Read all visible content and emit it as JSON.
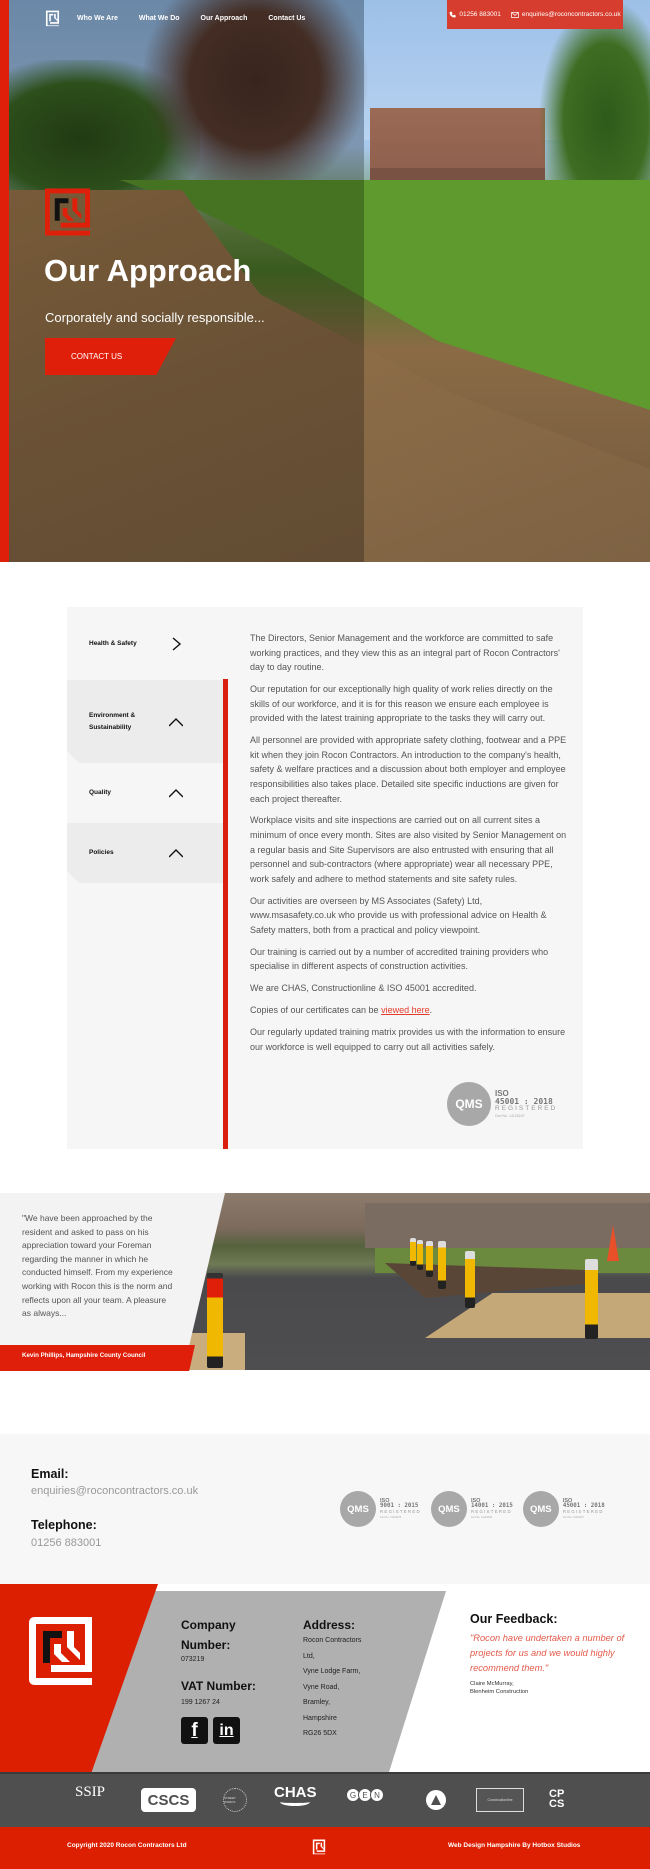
{
  "header": {
    "nav": [
      "Who We Are",
      "What We Do",
      "Our Approach",
      "Contact Us"
    ],
    "phone": "01256 883001",
    "email": "enquiries@roconcontractors.co.uk"
  },
  "hero": {
    "title": "Our Approach",
    "subtitle": "Corporately and socially responsible...",
    "cta_label": "CONTACT US"
  },
  "approach": {
    "tabs": [
      {
        "label": "Health & Safety",
        "icon": "chevron-right-icon",
        "active": true
      },
      {
        "label": "Environment & Sustainability",
        "icon": "chevron-up-icon",
        "active": false
      },
      {
        "label": "Quality",
        "icon": "chevron-up-icon",
        "active": false
      },
      {
        "label": "Policies",
        "icon": "chevron-up-icon",
        "active": false
      }
    ],
    "paragraphs": [
      "The Directors, Senior Management and the workforce are committed to safe working practices, and they view this as an integral part of Rocon Contractors' day to day routine.",
      "Our reputation for our exceptionally high quality of work relies directly on the skills of our workforce, and it is for this reason we ensure each employee is provided with the latest training appropriate to the tasks they will carry out.",
      "All personnel are provided with appropriate safety clothing, footwear and a PPE kit when they join Rocon Contractors. An introduction to the company's health, safety & welfare practices and a discussion about both employer and employee responsibilities also takes place. Detailed site specific inductions are given for each project thereafter.",
      "Workplace visits and site inspections are carried out on all current sites a minimum of once every month. Sites are also visited by Senior Management on a regular basis and Site Supervisors are also entrusted with ensuring that all personnel and sub-contractors (where appropriate) wear all necessary PPE, work safely and adhere to method statements and site safety rules.",
      "Our activities are overseen by MS Associates (Safety) Ltd, www.msasafety.co.uk who provide us with professional advice on Health & Safety matters, both from a practical and policy viewpoint.",
      "Our training is carried out by a number of accredited training providers who specialise in different aspects of construction activities.",
      "We are CHAS, Constructionline & ISO 45001 accredited."
    ],
    "cert_prefix": "Copies of our certificates can be ",
    "cert_link": "viewed here",
    "cert_suffix": ".",
    "last_paragraph": "Our regularly updated training matrix provides us with the information to ensure our workforce is well equipped to carry out all activities safely.",
    "badge": {
      "logo": "QMS",
      "iso": "ISO",
      "standard": "45001 : 2018",
      "status": "REGISTERED",
      "cert": "Cert No. 14126167"
    }
  },
  "testimonial": {
    "quote": "\"We have been approached by the resident and asked to pass on his appreciation toward your Foreman regarding the manner in which he conducted himself. From my experience working with Rocon this is the norm and reflects upon all your team. A pleasure as always...",
    "author": "Kevin Phillips, Hampshire County Council"
  },
  "contact": {
    "email_label": "Email:",
    "email": "enquiries@roconcontractors.co.uk",
    "phone_label": "Telephone:",
    "phone": "01256 883001",
    "badges": [
      {
        "logo": "QMS",
        "iso": "ISO",
        "standard": "9001 : 2015",
        "status": "REGISTERED",
        "cert": "Cert No. 14126165"
      },
      {
        "logo": "QMS",
        "iso": "ISO",
        "standard": "14001 : 2015",
        "status": "REGISTERED",
        "cert": "Cert No. 14126166"
      },
      {
        "logo": "QMS",
        "iso": "ISO",
        "standard": "45001 : 2018",
        "status": "REGISTERED",
        "cert": "Cert No. 14126167"
      }
    ]
  },
  "footer": {
    "company_label": "Company Number:",
    "company_number": "073219",
    "vat_label": "VAT Number:",
    "vat_number": "199 1267 24",
    "social": [
      {
        "name": "facebook-icon",
        "glyph": "f"
      },
      {
        "name": "linkedin-icon",
        "glyph": "in"
      }
    ],
    "address_label": "Address:",
    "address_lines": [
      "Rocon Contractors",
      "Ltd,",
      "Vyne Lodge Farm,",
      "Vyne Road,",
      "Bramley,",
      "Hampshire",
      "RG26 5DX"
    ],
    "feedback_label": "Our Feedback:",
    "feedback_quote": "\"Rocon have undertaken a number of projects for us and we would highly recommend them.\"",
    "feedback_author": "Claire McMurray,",
    "feedback_company": "Blenheim Construction",
    "accreditations": [
      "SSIP",
      "CSCS",
      "STREET WORKS",
      "CHAS",
      "GEN",
      "CONFINED SPACE",
      "Constructionline",
      "CPCS"
    ],
    "cpcs_line1": "CP",
    "cpcs_line2": "CS",
    "copyright": "Copyright 2020 Rocon Contractors Ltd",
    "credit": "Web Design Hampshire By Hotbox Studios"
  },
  "colors": {
    "brand_red": "#dc1f00",
    "contact_bar": "#d63d2e",
    "grey_band": "#b0b0b0",
    "accred_bar": "#4f4f4f",
    "link": "#e43c2b"
  }
}
